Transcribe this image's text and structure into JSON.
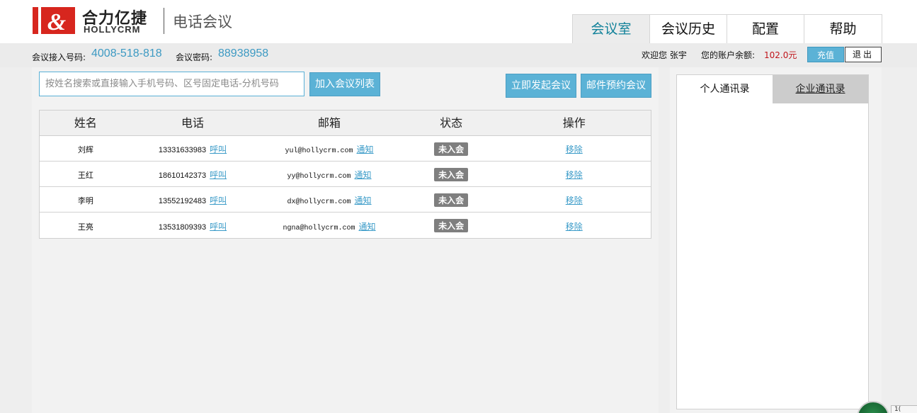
{
  "header": {
    "brand_cn": "合力亿捷",
    "brand_en": "HOLLYCRM",
    "product_name": "电话会议",
    "logo_glyph": "&",
    "logo_color": "#d7261e"
  },
  "nav": {
    "tabs": [
      {
        "label": "会议室",
        "active": true
      },
      {
        "label": "会议历史",
        "active": false
      },
      {
        "label": "配置",
        "active": false
      },
      {
        "label": "帮助",
        "active": false
      }
    ]
  },
  "infobar": {
    "access_label": "会议接入号码:",
    "access_number": "4008-518-818",
    "password_label": "会议密码:",
    "password": "88938958",
    "welcome": "欢迎您 张宇",
    "balance_label": "您的账户余额:",
    "balance": "102.0元",
    "recharge_label": "充值",
    "logout_label": "退出"
  },
  "toolbar": {
    "search_placeholder": "按姓名搜索或直接输入手机号码、区号固定电话-分机号码",
    "add_label": "加入会议列表",
    "start_label": "立即发起会议",
    "schedule_label": "邮件预约会议"
  },
  "table": {
    "headers": [
      "姓名",
      "电话",
      "邮箱",
      "状态",
      "操作"
    ],
    "call_label": "呼叫",
    "notify_label": "通知",
    "remove_label": "移除",
    "rows": [
      {
        "name": "刘辉",
        "phone": "13331633983",
        "email": "yul@hollycrm.com",
        "status": "未入会"
      },
      {
        "name": "王红",
        "phone": "18610142373",
        "email": "yy@hollycrm.com",
        "status": "未入会"
      },
      {
        "name": "李明",
        "phone": "13552192483",
        "email": "dx@hollycrm.com",
        "status": "未入会"
      },
      {
        "name": "王亮",
        "phone": "13531809393",
        "email": "ngna@hollycrm.com",
        "status": "未入会"
      }
    ]
  },
  "contacts": {
    "tab_personal": "个人通讯录",
    "tab_enterprise": "企业通讯录"
  },
  "corner": {
    "text": "1("
  },
  "colors": {
    "accent": "#5bb2d6",
    "link": "#3a9bc8",
    "active_tab_text": "#12829a",
    "balance": "#c0141a",
    "status_badge": "#7f7f7f"
  }
}
